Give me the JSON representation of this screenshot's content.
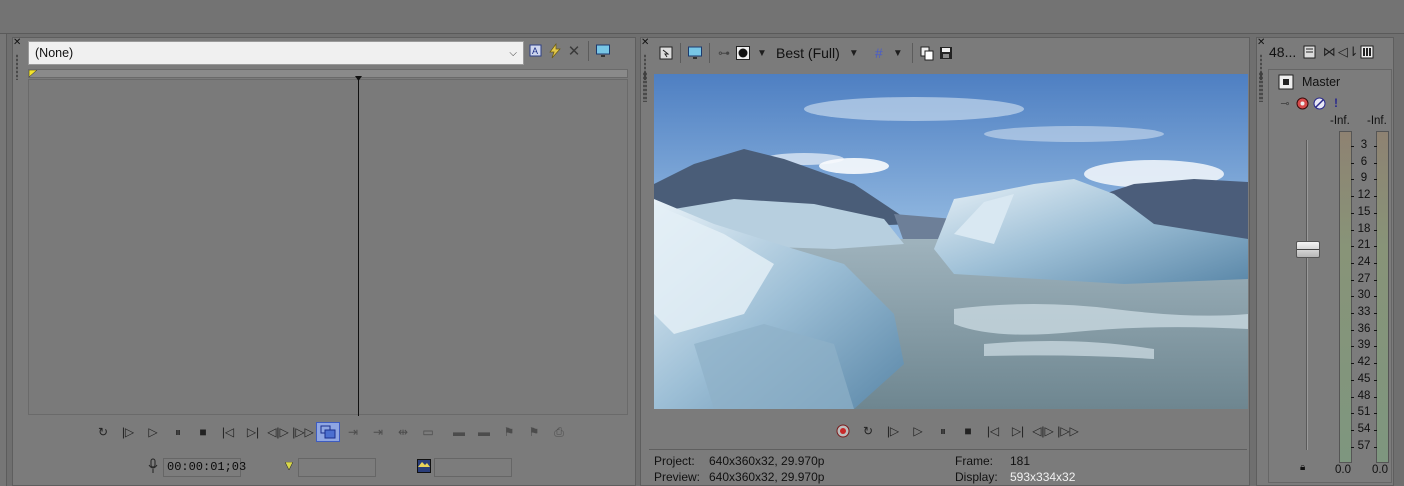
{
  "trimmer": {
    "media_select_value": "(None)",
    "timecode": "00:00:01;03",
    "icons": [
      "auto-preview-icon",
      "lightning-icon",
      "close-x-icon",
      "monitor-icon"
    ],
    "transport": [
      "loop-icon",
      "play-from-start-icon",
      "play-icon",
      "pause-icon",
      "stop-icon",
      "go-to-start-icon",
      "go-to-end-icon",
      "previous-frame-icon",
      "next-frame-icon"
    ],
    "edit_tools": [
      "select-region-icon",
      "add-to-timeline-start-icon",
      "add-to-timeline-end-icon",
      "fit-to-fill-icon",
      "overwrite-icon",
      "insert-icon",
      "replace-icon",
      "marker-icon",
      "region-icon",
      "save-snapshot-icon"
    ]
  },
  "preview": {
    "quality": "Best (Full)",
    "project_label": "Project:",
    "project_value": "640x360x32, 29.970p",
    "preview_label": "Preview:",
    "preview_value": "640x360x32, 29.970p",
    "frame_label": "Frame:",
    "frame_value": "181",
    "display_label": "Display:",
    "display_value": "593x334x32",
    "image_alt": "Glacier lake with icebergs and mountains",
    "transport": [
      "record-icon",
      "loop-icon",
      "play-from-start-icon",
      "play-icon",
      "pause-icon",
      "stop-icon",
      "go-to-start-icon",
      "go-to-end-icon",
      "previous-frame-icon",
      "next-frame-icon"
    ]
  },
  "mixer": {
    "sample_rate": "48...",
    "bus_name": "Master",
    "peak_left": "-Inf.",
    "peak_right": "-Inf.",
    "level_left": "0.0",
    "level_right": "0.0",
    "scale": [
      "3",
      "6",
      "9",
      "12",
      "15",
      "18",
      "21",
      "24",
      "27",
      "30",
      "33",
      "36",
      "39",
      "42",
      "45",
      "48",
      "51",
      "54",
      "57"
    ]
  },
  "colors": {
    "panel_bg": "#7b7b7b",
    "selected_tool": "#4b6fd0",
    "record": "#c82828"
  }
}
